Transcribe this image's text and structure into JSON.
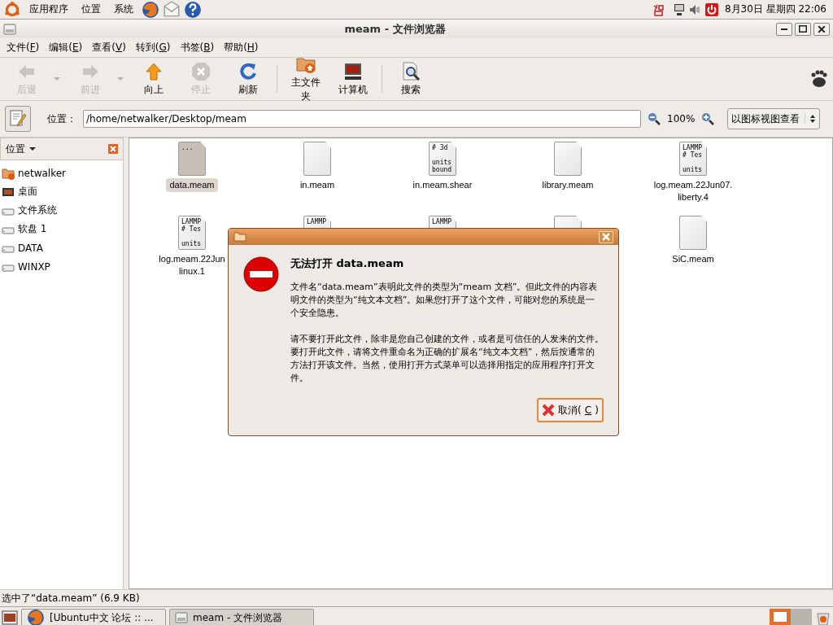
{
  "top_panel": {
    "menus": [
      "应用程序",
      "位置",
      "系统"
    ],
    "launchers": [
      {
        "kind": "browser"
      },
      {
        "kind": "mail"
      },
      {
        "kind": "help"
      }
    ],
    "tray": [
      {
        "kind": "input"
      },
      {
        "kind": "network"
      },
      {
        "kind": "volume"
      },
      {
        "kind": "power"
      }
    ],
    "clock": "8月30日 星期四 22:06"
  },
  "window": {
    "title": "meam - 文件浏览器",
    "menus": [
      {
        "before": "文件(",
        "key": "F",
        "after": ")"
      },
      {
        "before": "编辑(",
        "key": "E",
        "after": ")"
      },
      {
        "before": "查看(",
        "key": "V",
        "after": ")"
      },
      {
        "before": "转到(",
        "key": "G",
        "after": ")"
      },
      {
        "before": "书签(",
        "key": "B",
        "after": ")"
      },
      {
        "before": "帮助(",
        "key": "H",
        "after": ")"
      }
    ],
    "toolbar": [
      {
        "kind": "back",
        "label": "后退",
        "disabled": true,
        "dropdown": true
      },
      {
        "kind": "forward",
        "label": "前进",
        "disabled": true,
        "dropdown": true
      },
      {
        "kind": "up",
        "label": "向上",
        "disabled": false,
        "dropdown": false
      },
      {
        "kind": "stop",
        "label": "停止",
        "disabled": true,
        "dropdown": false
      },
      {
        "kind": "reload",
        "label": "刷新",
        "disabled": false,
        "dropdown": false
      },
      {
        "kind": "separator"
      },
      {
        "kind": "home",
        "label": "主文件夹",
        "disabled": false,
        "dropdown": false
      },
      {
        "kind": "computer",
        "label": "计算机",
        "disabled": false,
        "dropdown": false
      },
      {
        "kind": "separator"
      },
      {
        "kind": "search",
        "label": "搜索",
        "disabled": false,
        "dropdown": false
      }
    ],
    "location": {
      "label": "位置：",
      "path": "/home/netwalker/Desktop/meam",
      "zoom": "100%",
      "view": "以图标视图查看"
    },
    "sidebar": {
      "title": "位置",
      "items": [
        {
          "kind": "home",
          "label": "netwalker"
        },
        {
          "kind": "desktop",
          "label": "桌面"
        },
        {
          "kind": "drive",
          "label": "文件系统"
        },
        {
          "kind": "drive",
          "label": "软盘 1"
        },
        {
          "kind": "drive",
          "label": "DATA"
        },
        {
          "kind": "drive",
          "label": "WINXP"
        }
      ]
    },
    "files": [
      {
        "name": "data.meam",
        "preview": "...",
        "selected": true
      },
      {
        "name": "in.meam",
        "selected": false
      },
      {
        "name": "in.meam.shear",
        "preview": "# 3d\n\nunits\nbound",
        "selected": false
      },
      {
        "name": "library.meam",
        "selected": false
      },
      {
        "name": "log.meam.22Jun07.\nliberty.4",
        "preview": "LAMMP\n# Tes\n\nunits",
        "selected": false
      },
      {
        "name": "log.meam.22Jun\nlinux.1",
        "preview": "LAMMP\n# Tes\n\nunits",
        "selected": false
      },
      {
        "preview": "LAMMP",
        "selected": false
      },
      {
        "preview": "LAMMP",
        "selected": false
      },
      {
        "selected": false
      },
      {
        "name": "SiC.meam",
        "selected": false
      }
    ],
    "status_bar": "选中了“data.meam” (6.9 KB)"
  },
  "dialog": {
    "heading": "无法打开 data.meam",
    "paragraphs": [
      "文件名“data.meam”表明此文件的类型为“meam 文档”。但此文件的内容表明文件的类型为“纯文本文档”。如果您打开了这个文件，可能对您的系统是一个安全隐患。",
      "请不要打开此文件，除非是您自己创建的文件，或者是可信任的人发来的文件。要打开此文件，请将文件重命名为正确的扩展名“纯文本文档”，然后按通常的方法打开该文件。当然，使用打开方式菜单可以选择用指定的应用程序打开文件。"
    ],
    "button": {
      "before": "取消(",
      "key": "C",
      "after": ")"
    }
  },
  "taskbar": {
    "tasks": [
      {
        "kind": "browser",
        "label": "[Ubuntu中文 论坛 :: ...",
        "selected": false
      },
      {
        "kind": "files",
        "label": "meam - 文件浏览器",
        "selected": true
      }
    ]
  }
}
